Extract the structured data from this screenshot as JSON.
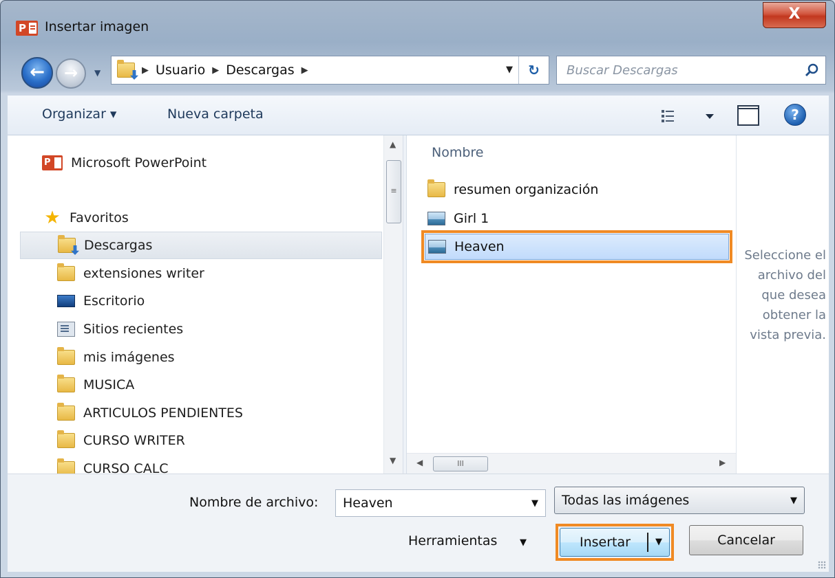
{
  "window": {
    "title": "Insertar imagen",
    "close_label": "X"
  },
  "address": {
    "crumbs": [
      "Usuario",
      "Descargas"
    ]
  },
  "search": {
    "placeholder": "Buscar Descargas"
  },
  "toolbar": {
    "organize": "Organizar ▾",
    "new_folder": "Nueva carpeta"
  },
  "nav": {
    "app": "Microsoft PowerPoint",
    "favorites": "Favoritos",
    "items": [
      {
        "label": "Descargas",
        "icon": "downloads-folder-icon",
        "selected": true
      },
      {
        "label": "extensiones writer",
        "icon": "folder-icon"
      },
      {
        "label": "Escritorio",
        "icon": "desktop-icon"
      },
      {
        "label": "Sitios recientes",
        "icon": "recent-places-icon"
      },
      {
        "label": "mis imágenes",
        "icon": "folder-icon"
      },
      {
        "label": "MUSICA",
        "icon": "folder-icon"
      },
      {
        "label": "ARTICULOS PENDIENTES",
        "icon": "folder-icon"
      },
      {
        "label": "CURSO WRITER",
        "icon": "folder-icon"
      },
      {
        "label": "CURSO CALC",
        "icon": "folder-icon"
      }
    ]
  },
  "files": {
    "column_header": "Nombre",
    "items": [
      {
        "name": "resumen organización",
        "icon": "folder-icon"
      },
      {
        "name": "Girl 1",
        "icon": "image-file-icon"
      },
      {
        "name": "Heaven",
        "icon": "image-file-icon",
        "selected": true
      }
    ]
  },
  "preview": {
    "message": "Seleccione el archivo del que desea obtener la vista previa."
  },
  "footer": {
    "filename_label": "Nombre de archivo:",
    "filename_value": "Heaven",
    "filetype_value": "Todas las imágenes",
    "tools_label": "Herramientas",
    "insert_label": "Insertar",
    "cancel_label": "Cancelar"
  },
  "colors": {
    "highlight": "#f08a24",
    "selection": "#c1dbfc",
    "accent": "#2a6fc9"
  }
}
